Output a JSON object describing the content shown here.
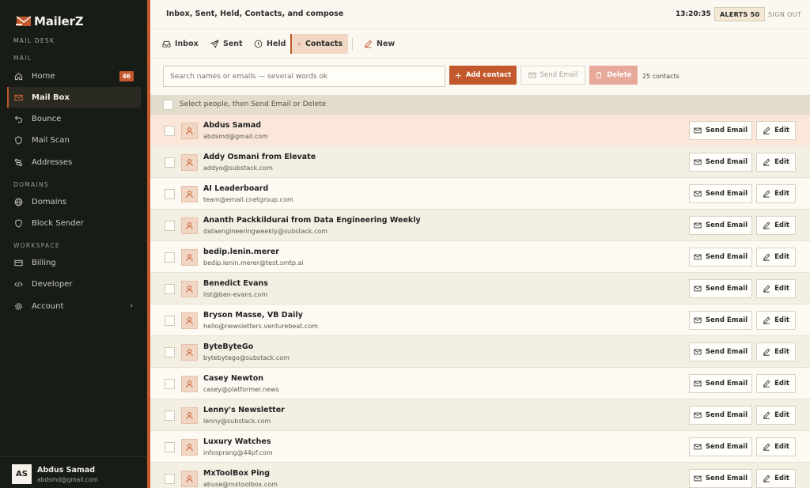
{
  "app": {
    "name": "MailerZ",
    "subtitle": "MAIL DESK"
  },
  "colors": {
    "accent": "#c2582b",
    "sidebar_bg": "#181c17",
    "page_bg": "#fbf8f1"
  },
  "sidebar": {
    "sections": [
      {
        "label": "MAIL",
        "items": [
          {
            "label": "Home",
            "icon": "home-icon",
            "badge": "46"
          },
          {
            "label": "Mail Box",
            "icon": "mail-icon",
            "active": true
          },
          {
            "label": "Bounce",
            "icon": "bounce-icon"
          },
          {
            "label": "Mail Scan",
            "icon": "shield-icon"
          },
          {
            "label": "Addresses",
            "icon": "addresses-icon"
          }
        ]
      },
      {
        "label": "DOMAINS",
        "items": [
          {
            "label": "Domains",
            "icon": "globe-icon"
          },
          {
            "label": "Block Sender",
            "icon": "block-icon"
          }
        ]
      },
      {
        "label": "WORKSPACE",
        "items": [
          {
            "label": "Billing",
            "icon": "card-icon"
          },
          {
            "label": "Developer",
            "icon": "code-icon"
          },
          {
            "label": "Account",
            "icon": "gear-icon"
          }
        ]
      }
    ],
    "user": {
      "initials": "AS",
      "name": "Abdus Samad",
      "email": "abdsmd@gmail.com"
    }
  },
  "topbar": {
    "title": "Inbox, Sent, Held, Contacts, and compose",
    "clock": "13:20:35",
    "alerts": "ALERTS 50",
    "signout": "SIGN OUT"
  },
  "tabs": [
    {
      "label": "Inbox",
      "icon": "inbox-icon"
    },
    {
      "label": "Sent",
      "icon": "send-icon"
    },
    {
      "label": "Held",
      "icon": "clock-icon"
    },
    {
      "label": "Contacts",
      "icon": "users-icon",
      "active": true
    },
    {
      "label": "New",
      "icon": "pencil-icon"
    }
  ],
  "toolbar": {
    "search_placeholder": "Search names or emails — several words ok",
    "add_label": "Add contact",
    "add_plus": "+",
    "send_label": "Send Email",
    "delete_label": "Delete",
    "count": "25 contacts"
  },
  "select_bar": {
    "text": "Select people, then Send Email or Delete"
  },
  "row_actions": {
    "send_label": "Send Email",
    "edit_label": "Edit"
  },
  "contacts": [
    {
      "name": "Abdus Samad",
      "email": "abdsmd@gmail.com"
    },
    {
      "name": "Addy Osmani from Elevate",
      "email": "addyo@substack.com"
    },
    {
      "name": "AI Leaderboard",
      "email": "team@email.cnetgroup.com"
    },
    {
      "name": "Ananth Packkildurai from Data Engineering Weekly",
      "email": "dataengineeringweekly@substack.com"
    },
    {
      "name": "bedip.lenin.merer",
      "email": "bedip.lenin.merer@test.smtp.ai"
    },
    {
      "name": "Benedict Evans",
      "email": "list@ben-evans.com"
    },
    {
      "name": "Bryson Masse, VB Daily",
      "email": "hello@newsletters.venturebeat.com"
    },
    {
      "name": "ByteByteGo",
      "email": "bytebytego@substack.com"
    },
    {
      "name": "Casey Newton",
      "email": "casey@platformer.news"
    },
    {
      "name": "Lenny's Newsletter",
      "email": "lenny@substack.com"
    },
    {
      "name": "Luxury Watches",
      "email": "infosprang@44pf.com"
    },
    {
      "name": "MxToolBox Ping",
      "email": "abuse@mxtoolbox.com"
    }
  ]
}
